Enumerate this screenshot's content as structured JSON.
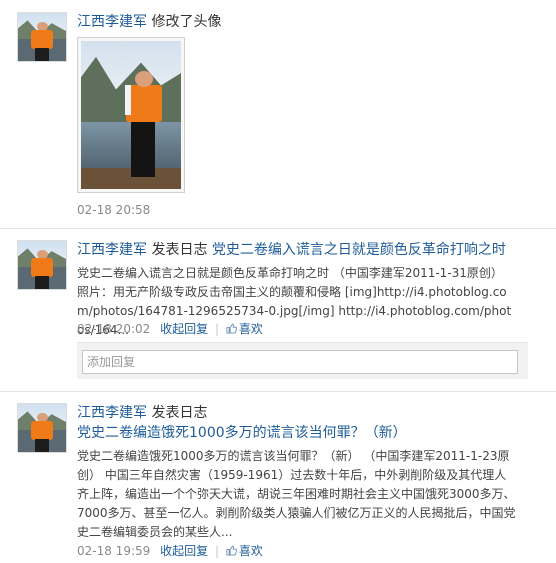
{
  "feed": {
    "item1": {
      "user": "江西李建军",
      "action": "修改了头像",
      "time": "02-18 20:58"
    },
    "item2": {
      "user": "江西李建军",
      "action": "发表日志",
      "post_title": "党史二卷编入谎言之日就是颜色反革命打响之时",
      "summary": "党史二卷编入谎言之日就是颜色反革命打响之时 （中国李建军2011-1-31原创） 照片：用无产阶级专政反击帝国主义的颠覆和侵略 [img]http://i4.photoblog.com/photos/164781-1296525734-0.jpg[/img] http://i4.photoblog.com/photos/164...",
      "time": "02-18 20:02",
      "reply_label": "收起回复",
      "like_label": "喜欢",
      "reply_placeholder": "添加回复"
    },
    "item3": {
      "user": "江西李建军",
      "action": "发表日志",
      "post_title": "党史二卷编造饿死1000多万的谎言该当何罪？（新）",
      "summary": "党史二卷编造饿死1000多万的谎言该当何罪？（新） （中国李建军2011-1-23原创） 中国三年自然灾害（1959-1961）过去数十年后，中外剥削阶级及其代理人齐上阵，编造出一个个弥天大谎，胡说三年困难时期社会主义中国饿死3000多万、7000多万、甚至一亿人。剥削阶级类人猿骗人们被亿万正义的人民揭批后，中国党史二卷编辑委员会的某些人...",
      "time": "02-18 19:59",
      "reply_label": "收起回复",
      "like_label": "喜欢"
    }
  },
  "colors": {
    "link": "#1f5c99",
    "text": "#333333",
    "meta": "#888888",
    "divider": "#e3e3e3"
  },
  "icons": {
    "like": "thumbs-up-icon",
    "avatar": "user-avatar"
  }
}
